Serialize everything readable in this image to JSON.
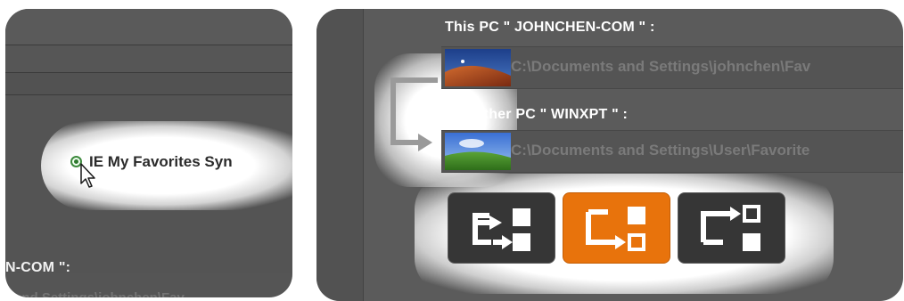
{
  "left_panel": {
    "option_label": "IE My Favorites Syn",
    "pc_label": "N-COM \":",
    "path_text": "and Settings\\johnchen\\Fav"
  },
  "right_panel": {
    "this_pc_label": "This PC \" JOHNCHEN-COM \" :",
    "this_pc_path": "C:\\Documents and Settings\\johnchen\\Fav",
    "other_pc_label": "The other PC \" WINXPT \" :",
    "other_pc_path": "C:\\Documents and Settings\\User\\Favorite"
  },
  "sync_modes": [
    {
      "icon": "sync-both-directions-icon",
      "active": false
    },
    {
      "icon": "sync-this-to-other-icon",
      "active": true
    },
    {
      "icon": "sync-other-to-this-icon",
      "active": false
    }
  ],
  "colors": {
    "accent": "#e8730c",
    "panel": "#555555",
    "button": "#363636",
    "radio": "#2f7a2f"
  }
}
